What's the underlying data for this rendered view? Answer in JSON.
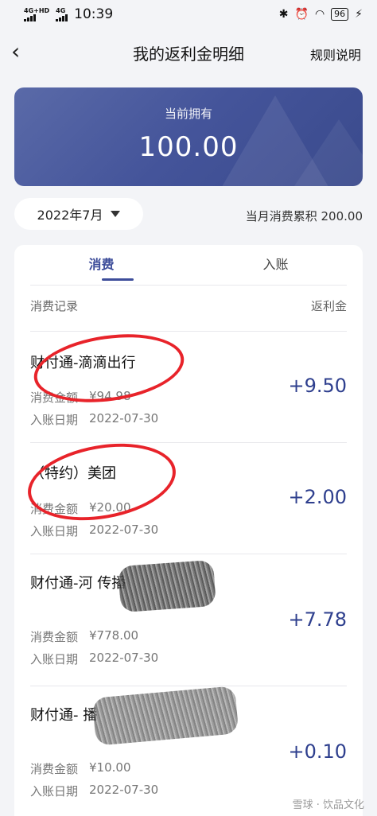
{
  "status_bar": {
    "network_1": "4G+HD",
    "network_2": "4G",
    "time": "10:39",
    "icons": [
      "bluetooth-icon",
      "alarm-icon",
      "wifi-icon"
    ],
    "battery": "96"
  },
  "nav": {
    "title": "我的返利金明细",
    "rules_label": "规则说明"
  },
  "balance": {
    "label": "当前拥有",
    "value": "100.00"
  },
  "month_picker": {
    "label": "2022年7月"
  },
  "month_total": "当月消费累积 200.00",
  "tabs": [
    {
      "label": "消费",
      "active": true
    },
    {
      "label": "入账",
      "active": false
    }
  ],
  "list_header": {
    "left": "消费记录",
    "right": "返利金"
  },
  "records": [
    {
      "title": "财付通-滴滴出行",
      "amount_label": "消费金额",
      "amount": "¥94.98",
      "date_label": "入账日期",
      "date": "2022-07-30",
      "rebate": "+9.50"
    },
    {
      "title": "（特约）美团",
      "amount_label": "消费金额",
      "amount": "¥20.00",
      "date_label": "入账日期",
      "date": "2022-07-30",
      "rebate": "+2.00"
    },
    {
      "title": "财付通-河                    传播",
      "amount_label": "消费金额",
      "amount": "¥778.00",
      "date_label": "入账日期",
      "date": "2022-07-30",
      "rebate": "+7.78"
    },
    {
      "title": "财付通-                           播",
      "amount_label": "消费金额",
      "amount": "¥10.00",
      "date_label": "入账日期",
      "date": "2022-07-30",
      "rebate": "+0.10"
    }
  ],
  "watermark": "雪球 · 饮品文化",
  "colors": {
    "accent": "#3d4d9a",
    "card_start": "#5a6aa8",
    "card_end": "#3a4a8c",
    "annotation": "#e8232a"
  }
}
